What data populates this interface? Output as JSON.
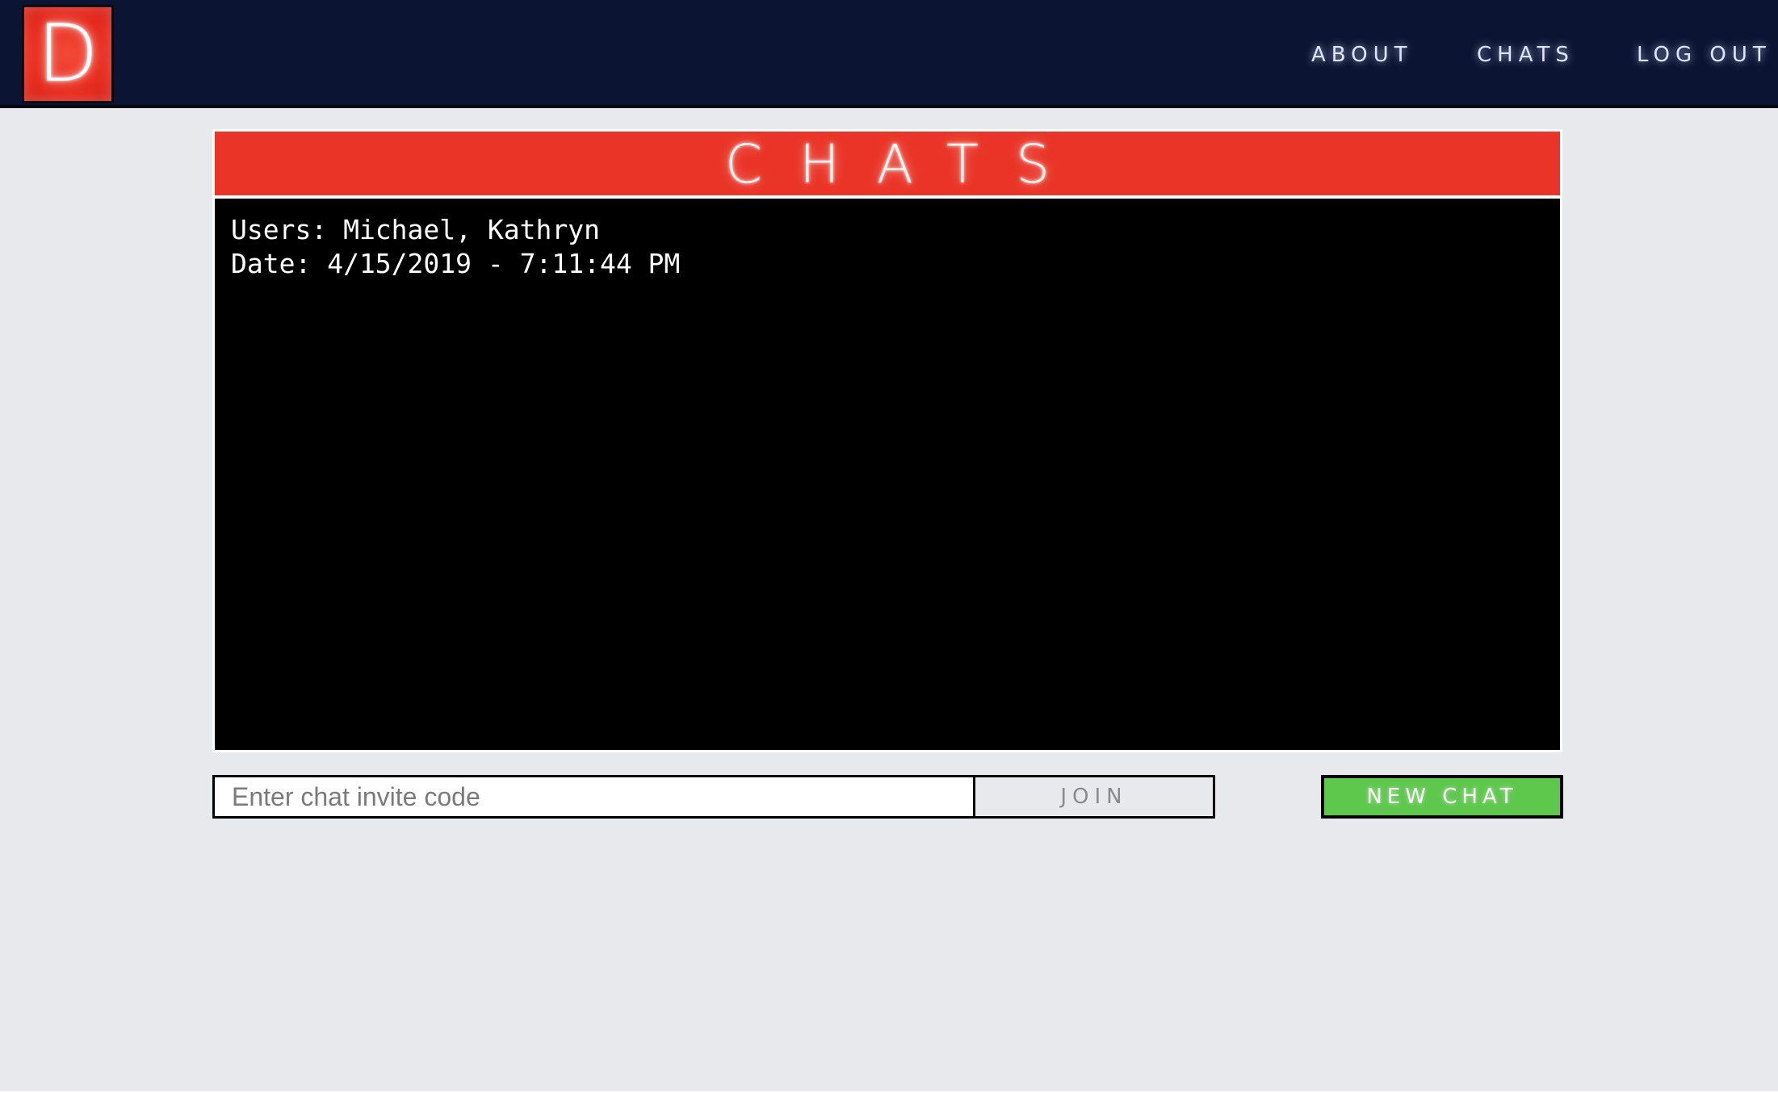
{
  "navbar": {
    "logo_letter": "D",
    "links": {
      "about": "ABOUT",
      "chats": "CHATS",
      "logout": "LOG OUT"
    }
  },
  "panel": {
    "title": "CHATS",
    "chats": [
      {
        "users": "Users: Michael, Kathryn",
        "date": "Date: 4/15/2019 - 7:11:44 PM"
      }
    ]
  },
  "controls": {
    "invite_placeholder": "Enter chat invite code",
    "invite_value": "",
    "join_label": "JOIN",
    "new_chat_label": "NEW CHAT"
  },
  "colors": {
    "navbar_bg": "#0b1433",
    "accent_red": "#e93427",
    "chat_bg": "#000000",
    "new_chat_green": "#5ec84d",
    "page_bg": "#e8e9ed"
  }
}
